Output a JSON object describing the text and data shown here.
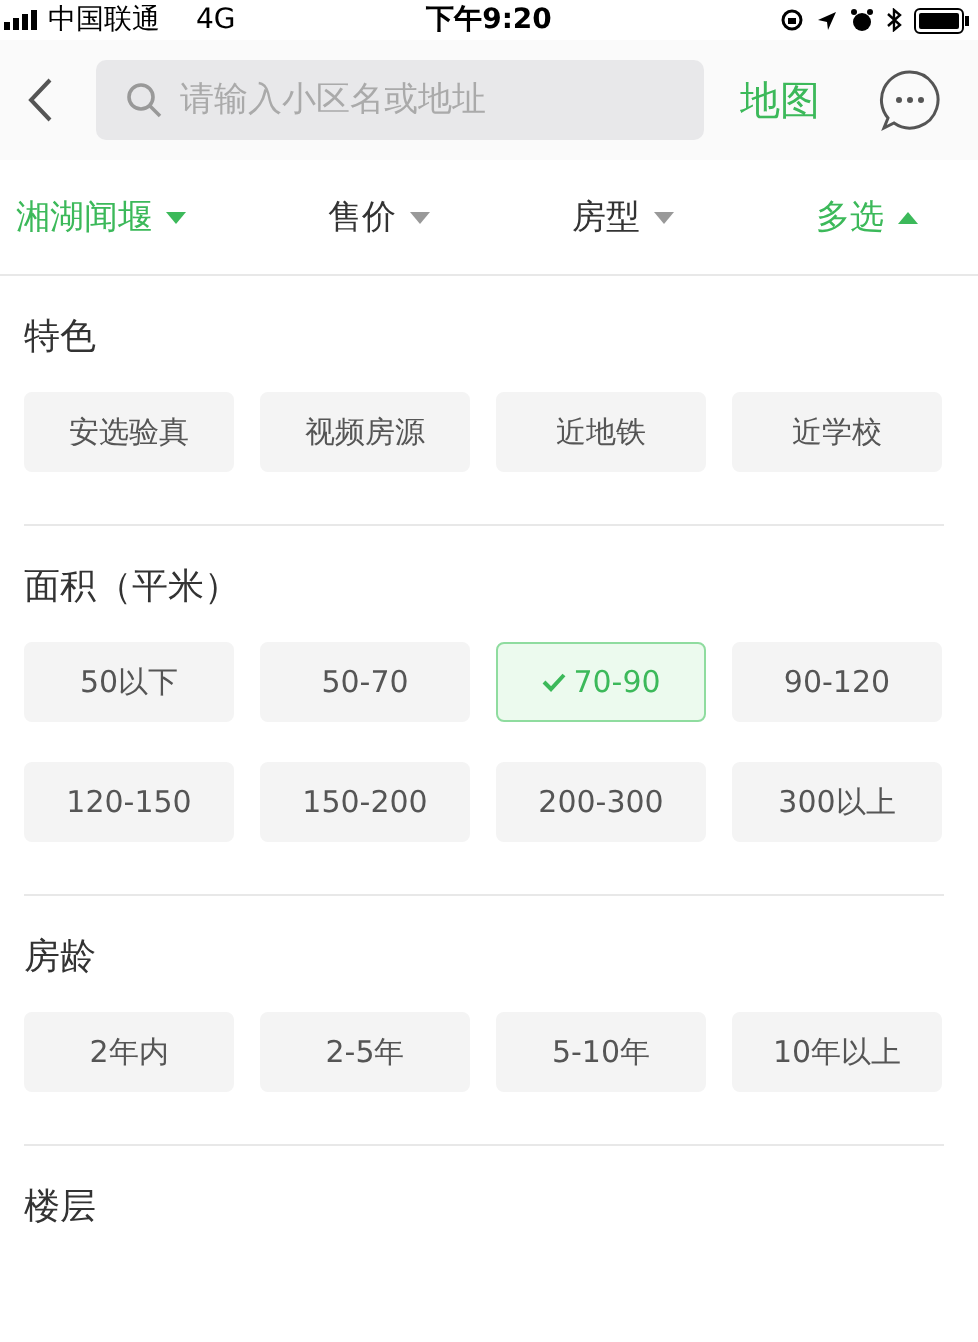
{
  "status_bar": {
    "carrier": "中国联通",
    "network": "4G",
    "time": "下午9:20"
  },
  "nav_bar": {
    "search": {
      "placeholder": "请输入小区名或地址"
    },
    "map_link": "地图"
  },
  "filters": [
    {
      "label": "湘湖闻堰",
      "selected": true,
      "expanded": false
    },
    {
      "label": "售价",
      "selected": false,
      "expanded": false
    },
    {
      "label": "房型",
      "selected": false,
      "expanded": false
    },
    {
      "label": "多选",
      "selected": true,
      "expanded": true
    }
  ],
  "sections": [
    {
      "title": "特色",
      "options": [
        {
          "label": "安选验真",
          "selected": false
        },
        {
          "label": "视频房源",
          "selected": false
        },
        {
          "label": "近地铁",
          "selected": false
        },
        {
          "label": "近学校",
          "selected": false
        }
      ]
    },
    {
      "title": "面积（平米）",
      "options": [
        {
          "label": "50以下",
          "selected": false
        },
        {
          "label": "50-70",
          "selected": false
        },
        {
          "label": "70-90",
          "selected": true
        },
        {
          "label": "90-120",
          "selected": false
        },
        {
          "label": "120-150",
          "selected": false
        },
        {
          "label": "150-200",
          "selected": false
        },
        {
          "label": "200-300",
          "selected": false
        },
        {
          "label": "300以上",
          "selected": false
        }
      ]
    },
    {
      "title": "房龄",
      "options": [
        {
          "label": "2年内",
          "selected": false
        },
        {
          "label": "2-5年",
          "selected": false
        },
        {
          "label": "5-10年",
          "selected": false
        },
        {
          "label": "10年以上",
          "selected": false
        }
      ]
    },
    {
      "title": "楼层"
    }
  ]
}
